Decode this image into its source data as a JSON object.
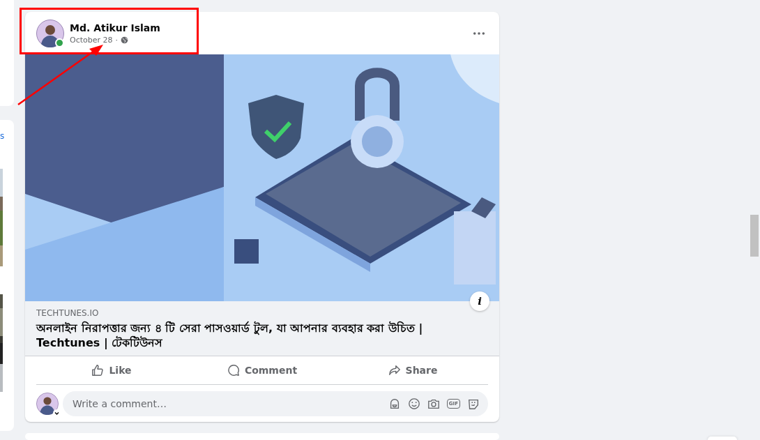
{
  "left_column": {
    "link_text": "s"
  },
  "post": {
    "author": "Md. Atikur Islam",
    "online": true,
    "date": "October 28",
    "separator": "·",
    "link": {
      "domain": "TECHTUNES.IO",
      "title": "অনলাইন নিরাপত্তার জন্য ৪ টি সেরা পাসওয়ার্ড টুল, যা আপনার ব্যবহার করা উচিত | Techtunes | টেকটিউনস",
      "info_label": "i"
    },
    "actions": [
      {
        "kind": "like",
        "label": "Like"
      },
      {
        "kind": "comment",
        "label": "Comment"
      },
      {
        "kind": "share",
        "label": "Share"
      }
    ],
    "comment_box": {
      "placeholder": "Write a comment…",
      "gif_label": "GIF"
    }
  }
}
